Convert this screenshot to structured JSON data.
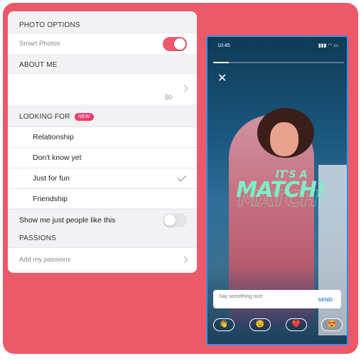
{
  "settings": {
    "photo_options": {
      "heading": "PHOTO OPTIONS",
      "smart_photos_label": "Smart Photos",
      "smart_photos_on": true
    },
    "about_me": {
      "heading": "ABOUT ME",
      "char_count": "50"
    },
    "looking_for": {
      "heading": "LOOKING FOR",
      "badge": "NEW",
      "options": [
        "Relationship",
        "Don't know yet",
        "Just for fun",
        "Friendship"
      ],
      "selected": "Just for fun"
    },
    "show_like_me": {
      "label": "Show me just people like this",
      "on": false
    },
    "passions": {
      "heading": "PASSIONS",
      "add_label": "Add my passions"
    }
  },
  "phone": {
    "time": "10:45",
    "match_small": "IT'S A",
    "match_big": "MATCH!",
    "message_placeholder": "Say something nice",
    "send_label": "SEND",
    "emojis": [
      "👋",
      "😉",
      "❤️",
      "😍"
    ],
    "progress": 0.12
  },
  "colors": {
    "background": "#ec5a6a",
    "toggle_on": "#ec5a6a",
    "toggle_off": "#e4e4e8",
    "match_text": "#7ef0c8",
    "phone_border": "#3b8fe6"
  }
}
